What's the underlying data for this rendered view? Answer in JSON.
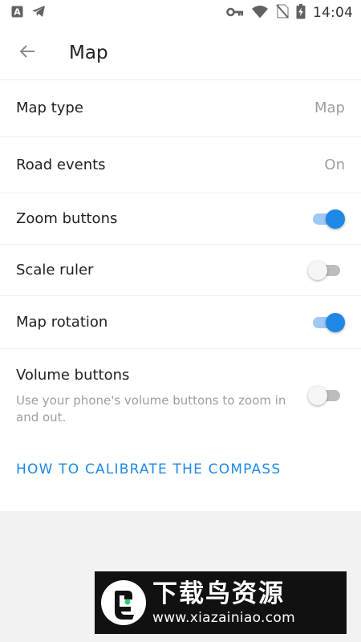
{
  "status_bar": {
    "time": "14:04",
    "left_icons": [
      "a-badge-icon",
      "telegram-icon"
    ],
    "right_icons": [
      "key-icon",
      "wifi-icon",
      "no-sim-icon",
      "battery-charging-icon"
    ]
  },
  "app_bar": {
    "back_icon": "arrow-left-icon",
    "title": "Map"
  },
  "settings": {
    "map_type": {
      "label": "Map type",
      "value": "Map"
    },
    "road_events": {
      "label": "Road events",
      "value": "On"
    },
    "zoom_buttons": {
      "label": "Zoom buttons",
      "enabled": true
    },
    "scale_ruler": {
      "label": "Scale ruler",
      "enabled": false
    },
    "map_rotation": {
      "label": "Map rotation",
      "enabled": true
    },
    "volume_buttons": {
      "label": "Volume buttons",
      "description": "Use your phone's volume buttons to zoom in and out.",
      "enabled": false
    }
  },
  "calibrate_link": "HOW TO CALIBRATE THE COMPASS",
  "watermark": {
    "title": "下载鸟资源",
    "url": "www.xiazainiao.com"
  },
  "colors": {
    "accent": "#1e88e5",
    "switch_on_track": "#9fc9f7",
    "switch_off_track": "#bdbdbd",
    "secondary_text": "#9e9e9e",
    "background": "#f2f2f2"
  }
}
